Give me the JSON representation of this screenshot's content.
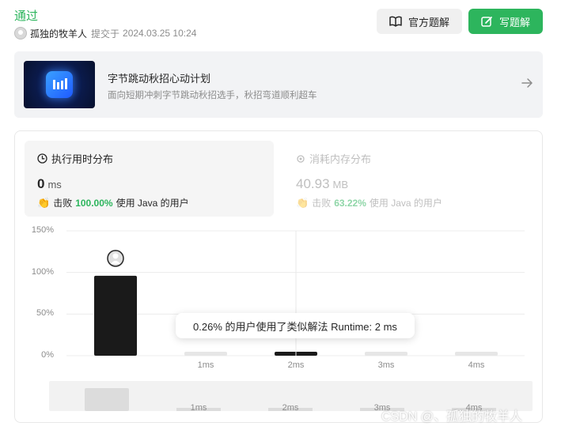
{
  "header": {
    "status": "通过",
    "user": "孤独的牧羊人",
    "submitted_label": "提交于",
    "submitted_time": "2024.03.25 10:24",
    "official_solution_label": "官方题解",
    "write_solution_label": "写题解",
    "accent_color": "#2db55d"
  },
  "banner": {
    "title": "字节跳动秋招心动计划",
    "subtitle": "面向短期冲刺字节跳动秋招选手，秋招弯道顺利超车",
    "icon": "arrow-right-icon"
  },
  "runtime_tab": {
    "title": "执行用时分布",
    "value": "0",
    "unit": "ms",
    "beat_label": "击败",
    "beat_pct": "100.00%",
    "beat_suffix": "使用 Java 的用户"
  },
  "memory_tab": {
    "title": "消耗内存分布",
    "value": "40.93",
    "unit": "MB",
    "beat_label": "击败",
    "beat_pct": "63.22%",
    "beat_suffix": "使用 Java 的用户"
  },
  "chart_data": {
    "type": "bar",
    "y_tick_labels": [
      "150%",
      "100%",
      "50%",
      "0%"
    ],
    "categories": [
      "",
      "1ms",
      "2ms",
      "3ms",
      "4ms"
    ],
    "values": [
      96,
      0.3,
      0.26,
      0.2,
      0.2
    ],
    "ylim": [
      0,
      150
    ],
    "grid": true,
    "highlight_index": 0,
    "hover_index": 2,
    "colors": {
      "highlight": "#1a1a1a",
      "normal": "#e6e6e6",
      "hover": "#1a1a1a"
    }
  },
  "tooltip": {
    "text": "0.26% 的用户使用了类似解法 Runtime: 2 ms"
  },
  "minimap": {
    "labels": [
      "1ms",
      "2ms",
      "3ms",
      "4ms"
    ]
  },
  "watermark": "CSDN @、孤独的牧羊人"
}
